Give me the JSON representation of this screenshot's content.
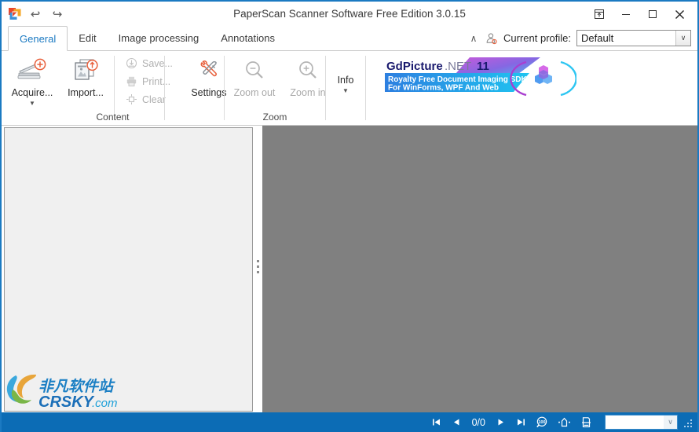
{
  "window": {
    "title": "PaperScan Scanner Software Free Edition 3.0.15",
    "app_icon": "paperscan-app-icon",
    "quick_access": [
      {
        "name": "undo",
        "glyph": "↩"
      },
      {
        "name": "redo",
        "glyph": "↪"
      }
    ],
    "controls": [
      {
        "name": "ribbon-display-options",
        "glyph": "⤒",
        "label": "Ribbon Display Options"
      },
      {
        "name": "minimize",
        "glyph": "─",
        "label": "Minimize"
      },
      {
        "name": "maximize",
        "glyph": "□",
        "label": "Maximize"
      },
      {
        "name": "close",
        "glyph": "✕",
        "label": "Close"
      }
    ]
  },
  "tabs": [
    {
      "label": "General",
      "active": true
    },
    {
      "label": "Edit",
      "active": false
    },
    {
      "label": "Image processing",
      "active": false
    },
    {
      "label": "Annotations",
      "active": false
    }
  ],
  "profile": {
    "collapse_glyph": "∧",
    "icon": "user-profile-icon",
    "label": "Current profile:",
    "value": "Default",
    "arrow": "∨"
  },
  "ribbon": {
    "groups": [
      {
        "name": "content",
        "title": "Content",
        "big_buttons": [
          {
            "name": "acquire",
            "label": "Acquire...",
            "icon": "scanner-add-icon",
            "has_dropdown": true,
            "disabled": false
          },
          {
            "name": "import",
            "label": "Import...",
            "icon": "import-document-icon",
            "has_dropdown": false,
            "disabled": false
          }
        ],
        "small_buttons": [
          {
            "name": "save",
            "label": "Save...",
            "icon": "save-disk-icon",
            "disabled": true
          },
          {
            "name": "print",
            "label": "Print...",
            "icon": "printer-icon",
            "disabled": true
          },
          {
            "name": "clear",
            "label": "Clear",
            "icon": "clear-icon",
            "disabled": true
          }
        ],
        "settings": {
          "name": "settings",
          "label": "Settings",
          "icon": "wrench-screwdriver-icon",
          "disabled": false
        }
      },
      {
        "name": "zoom",
        "title": "Zoom",
        "big_buttons": [
          {
            "name": "zoom-out",
            "label": "Zoom out",
            "icon": "magnifier-minus-icon",
            "has_dropdown": false,
            "disabled": true
          },
          {
            "name": "zoom-in",
            "label": "Zoom in",
            "icon": "magnifier-plus-icon",
            "has_dropdown": false,
            "disabled": true
          }
        ]
      },
      {
        "name": "info",
        "title": "",
        "big_buttons": [
          {
            "name": "info",
            "label": "Info",
            "icon": "info-icon",
            "has_dropdown": true,
            "disabled": false
          }
        ]
      }
    ]
  },
  "banner": {
    "brand_bold": "GdPicture",
    "brand_rest": ".NET",
    "version": "11",
    "tagline_line1": "Royalty Free Document Imaging SDK",
    "tagline_line2": "For WinForms, WPF And Web",
    "logo_icon": "gdpicture-cube-logo",
    "colors": {
      "magenta": "#e040c8",
      "cyan": "#1ec8f0",
      "purple": "#8a3fc0",
      "blue": "#2a7fd4"
    }
  },
  "workspace": {
    "thumbnail_panel": {
      "name": "thumbnail-panel",
      "background": "#f0f0f0"
    },
    "splitter": {
      "name": "panel-splitter"
    },
    "viewer": {
      "name": "document-viewer",
      "background": "#808080"
    }
  },
  "statusbar": {
    "background": "#0c6cb5",
    "nav": [
      {
        "name": "first-page",
        "glyph": "⏮"
      },
      {
        "name": "previous-page",
        "glyph": "◀"
      }
    ],
    "page_indicator": "0/0",
    "nav_after": [
      {
        "name": "next-page",
        "glyph": "▶"
      },
      {
        "name": "last-page",
        "glyph": "⏭"
      }
    ],
    "tools": [
      {
        "name": "zoom-100-percent-icon",
        "label": "100%"
      },
      {
        "name": "fit-page-icon",
        "label": "Fit page"
      },
      {
        "name": "fit-width-icon",
        "label": "Fit width"
      }
    ],
    "zoom_value": "",
    "zoom_arrow": "∨"
  },
  "watermark": {
    "cn_text": "非凡软件站",
    "en_text": "CRSKY",
    "en_suffix": ".com",
    "colors": {
      "blue": "#1b7fc4",
      "orange": "#e8a53a",
      "green": "#7ab648"
    }
  }
}
